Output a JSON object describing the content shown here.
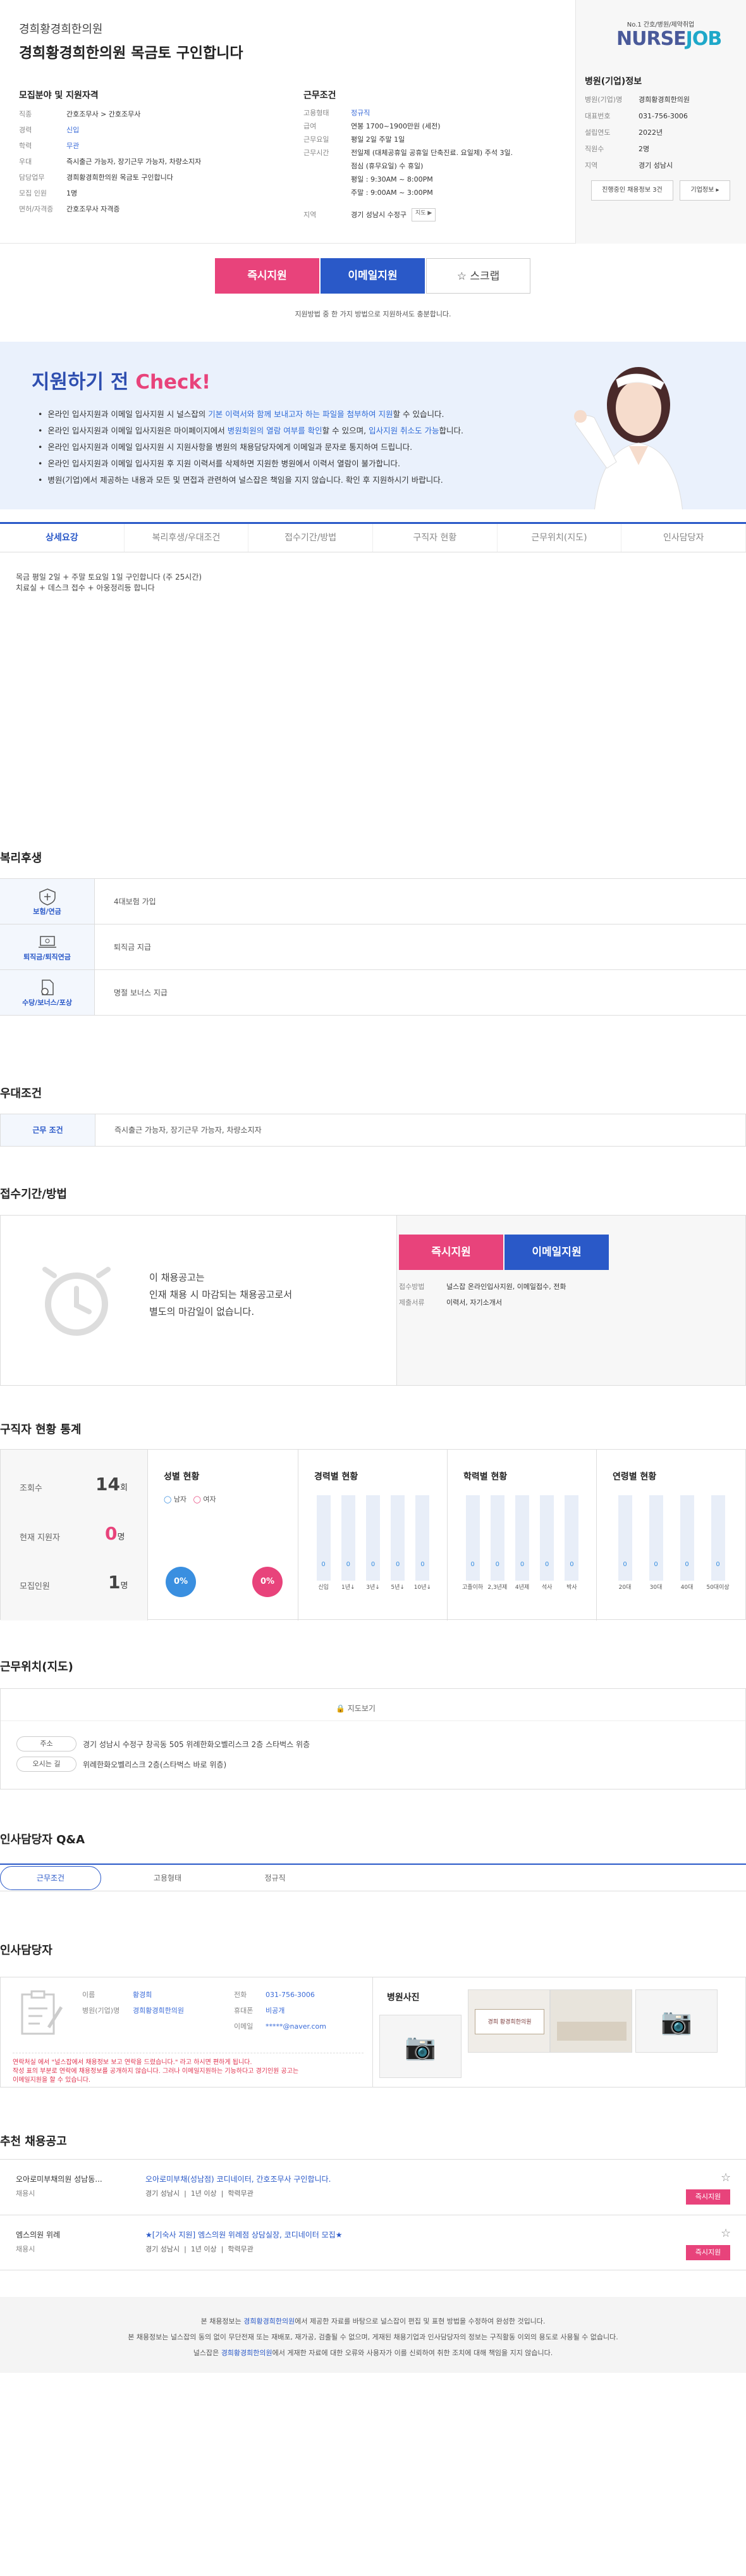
{
  "header": {
    "hospital_name": "경희황경희한의원",
    "job_title": "경희황경희한의원 목금토 구인합니다"
  },
  "recruit": {
    "heading": "모집분야 및 지원자격",
    "rows": [
      {
        "k": "직종",
        "v": "간호조무사 > 간호조무사"
      },
      {
        "k": "경력",
        "v": "신입"
      },
      {
        "k": "학력",
        "v": "무관"
      },
      {
        "k": "우대",
        "v": "즉시출근 가능자, 장기근무 가능자, 차량소지자"
      },
      {
        "k": "담당업무",
        "v": "경희황경희한의원 목금토 구인합니다"
      },
      {
        "k": "모집 인원",
        "v": "1명"
      },
      {
        "k": "면허/자격증",
        "v": "간호조무사 자격증"
      }
    ]
  },
  "conditions": {
    "heading": "근무조건",
    "rows": [
      {
        "k": "고용형태",
        "v": "정규직"
      },
      {
        "k": "급여",
        "v": "연봉 1700~1900만원 (세전)"
      },
      {
        "k": "근무요일",
        "v": "평일 2일 주말 1일"
      },
      {
        "k": "근무시간",
        "v": "전일제 (대체공휴일 공휴일 단축진료. 요일제) 주석 3일."
      },
      {
        "k": "",
        "v": "점심 (휴무요일) 수 휴일)"
      },
      {
        "k": "",
        "v": "평일 : 9:30AM ~ 8:00PM"
      },
      {
        "k": "",
        "v": "주말 : 9:00AM ~ 3:00PM"
      },
      {
        "k": "지역",
        "v": "경기 성남시 수정구"
      }
    ],
    "map_button": "지도 ▶"
  },
  "brand": {
    "small": "No.1 간호/병원/제약취업",
    "big_a": "NURSE",
    "big_b": "JOB"
  },
  "company": {
    "heading": "병원(기업)정보",
    "rows": [
      {
        "k": "병원(기업)명",
        "v": "경희황경희한의원"
      },
      {
        "k": "대표번호",
        "v": "031-756-3006"
      },
      {
        "k": "설립연도",
        "v": "2022년"
      },
      {
        "k": "직원수",
        "v": "2명"
      },
      {
        "k": "지역",
        "v": "경기 성남시"
      }
    ],
    "btn_jobs": "진행중인 채용정보 3건",
    "btn_info": "기업정보 ▸"
  },
  "apply_buttons": {
    "instant": "즉시지원",
    "email": "이메일지원",
    "scrap": "스크랩",
    "note": "지원방법 중 한 가지 방법으로 지원하셔도 충분합니다."
  },
  "check": {
    "title_a": "지원하기 전",
    "title_b": "Check!",
    "items": [
      {
        "a": "온라인 입사지원과 이메일 입사지원 시 널스잡의 ",
        "h": "기본 이력서와 함께 보내고자 하는 파일을 첨부하여 지원",
        "b": "할 수 있습니다."
      },
      {
        "a": "온라인 입사지원과 이메일 입사지원은 마이페이지에서 ",
        "h": "병원회원의 열람 여부를 확인",
        "b": "할 수 있으며, ",
        "h2": "입사지원 취소도 가능",
        "c": "합니다."
      },
      {
        "a": "온라인 입사지원과 이메일 입사지원 시 지원사항을 병원의 채용담당자에게 이메일과 문자로 통지하여 드립니다.",
        "h": "",
        "b": ""
      },
      {
        "a": "온라인 입사지원과 이메일 입사지원 후 지원 이력서를 삭제하면 지원한 병원에서 이력서 열람이 불가합니다.",
        "h": "",
        "b": ""
      },
      {
        "a": "병원(기업)에서 제공하는 내용과 모든 및 면접과 관련하여 널스잡은 책임을 지지 않습니다. 확인 후 지원하시기 바랍니다.",
        "h": "",
        "b": ""
      }
    ]
  },
  "tabs": [
    "상세요강",
    "복리후생/우대조건",
    "접수기간/방법",
    "구직자 현황",
    "근무위치(지도)",
    "인사담당자"
  ],
  "detail_text": [
    "목금 평일 2일 + 주말 토요일 1일 구인합니다 (주 25시간)",
    "치료실 + 데스크 접수 + 아웅정리등 합니다"
  ],
  "benefits": {
    "heading": "복리후생",
    "rows": [
      {
        "icon": "보험/연금",
        "text": "4대보험 가입"
      },
      {
        "icon": "퇴직금/퇴직연금",
        "text": "퇴직금 지급"
      },
      {
        "icon": "수당/보너스/포상",
        "text": "명절 보너스 지급"
      }
    ]
  },
  "preferred": {
    "heading": "우대조건",
    "key": "근무 조건",
    "value": "즉시출근 가능자, 장기근무 가능자, 차량소지자"
  },
  "apply_period": {
    "heading": "접수기간/방법",
    "message": [
      "이 채용공고는",
      "인재 채용 시 마감되는 채용공고로서",
      "별도의 마감일이 없습니다."
    ],
    "instant": "즉시지원",
    "email": "이메일지원",
    "rows": [
      {
        "k": "접수방법",
        "v": "널스잡 온라인입사지원, 이메일접수, 전화"
      },
      {
        "k": "제출서류",
        "v": "이력서, 자기소개서"
      }
    ]
  },
  "stats": {
    "heading": "구직자 현황 통계",
    "views_label": "조회수",
    "views": "14",
    "views_unit": "회",
    "applicants_label": "현재 지원자",
    "applicants": "0",
    "applicants_unit": "명",
    "recruit_label": "모집인원",
    "recruit": "1",
    "recruit_unit": "명",
    "gender_title": "성별 현황",
    "male": "남자",
    "female": "여자",
    "male_pct": "0%",
    "female_pct": "0%",
    "career_title": "경력별 현황",
    "career": [
      {
        "v": "0",
        "l": "신입"
      },
      {
        "v": "0",
        "l": "1년↓"
      },
      {
        "v": "0",
        "l": "3년↓"
      },
      {
        "v": "0",
        "l": "5년↓"
      },
      {
        "v": "0",
        "l": "10년↓"
      }
    ],
    "edu_title": "학력별 현황",
    "edu": [
      {
        "v": "0",
        "l": "고졸이하"
      },
      {
        "v": "0",
        "l": "2,3년제"
      },
      {
        "v": "0",
        "l": "4년제"
      },
      {
        "v": "0",
        "l": "석사"
      },
      {
        "v": "0",
        "l": "박사"
      }
    ],
    "age_title": "연령별 현황",
    "age": [
      {
        "v": "0",
        "l": "20대"
      },
      {
        "v": "0",
        "l": "30대"
      },
      {
        "v": "0",
        "l": "40대"
      },
      {
        "v": "0",
        "l": "50대이상"
      }
    ]
  },
  "location": {
    "heading": "근무위치(지도)",
    "map_btn": "지도보기",
    "addr_label": "주소",
    "addr": "경기 성남시 수정구 창곡동 505 위례한화오벨리스크 2층 스타벅스 위층",
    "route_label": "오시는 길",
    "route": "위례한화오벨리스크 2층(스타벅스 바로 위층)"
  },
  "qa": {
    "heading": "인사담당자 Q&A",
    "tabs": [
      "근무조건",
      "고용형태",
      "정규직"
    ]
  },
  "hr": {
    "heading": "인사담당자",
    "rows_left": [
      {
        "k": "이름",
        "v": "황경희"
      },
      {
        "k": "병원(기업)명",
        "v": "경희황경희한의원"
      }
    ],
    "rows_right": [
      {
        "k": "전화",
        "v": "031-756-3006"
      },
      {
        "k": "휴대폰",
        "v": "비공개"
      },
      {
        "k": "이메일",
        "v": "*****@naver.com"
      }
    ],
    "warning": [
      "연락처실 에서 \"널스잡에서 채용정보 보고 연락을 드렸습니다.\" 라고 하시면 편하게 됩니다.",
      "작성 표의 부분로 연락에 채용정보를 공개하지 않습니다. 그러나 이메일지원하는 기능하다고 경기인원 공고는",
      "이메일지원을 할 수 있습니다."
    ],
    "photo_title": "병원사진",
    "signboard": "경희 황경희한의원"
  },
  "recommend": {
    "heading": "추천 채용공고",
    "items": [
      {
        "company": "오아로미부채의원 성남동...",
        "tag": "채용시",
        "title": "오아로미부채(성남점) 코디네이터, 간호조무사 구인합니다.",
        "meta": [
          "경기 성남시",
          "1년 이상",
          "학력무관"
        ],
        "btn": "즉시지원"
      },
      {
        "company": "엠스의원 위례",
        "tag": "채용시",
        "title": "★[기숙사 지원] 엠스의원 위례점 상담실장, 코디네이터 모집★",
        "meta": [
          "경기 성남시",
          "1년 이상",
          "학력무관"
        ],
        "btn": "즉시지원"
      }
    ]
  },
  "footer": {
    "line1_a": "본 채용정보는 ",
    "line1_h": "경희황경희한의원",
    "line1_b": "에서 제공한 자료를 바탕으로 널스잡이 편집 및 표현 방법을 수정하여 완성한 것입니다.",
    "line2": "본 채용정보는 널스잡의 동의 없이 무단전재 또는 재배포, 재가공, 검출될 수 없으며, 게재된 채용기업과 인사담당자의 정보는 구직활동 이외의 용도로 사용될 수 없습니다.",
    "line3_a": "널스잡은 ",
    "line3_h": "경희황경희한의원",
    "line3_b": "에서 게재한 자료에 대한 오류와 사용자가 이를 신뢰하여 취한 조치에 대해 책임을 지지 않습니다."
  },
  "colors": {
    "pink": "#e8437b",
    "blue": "#2a59c8",
    "accent_teal": "#1fa8c9"
  }
}
